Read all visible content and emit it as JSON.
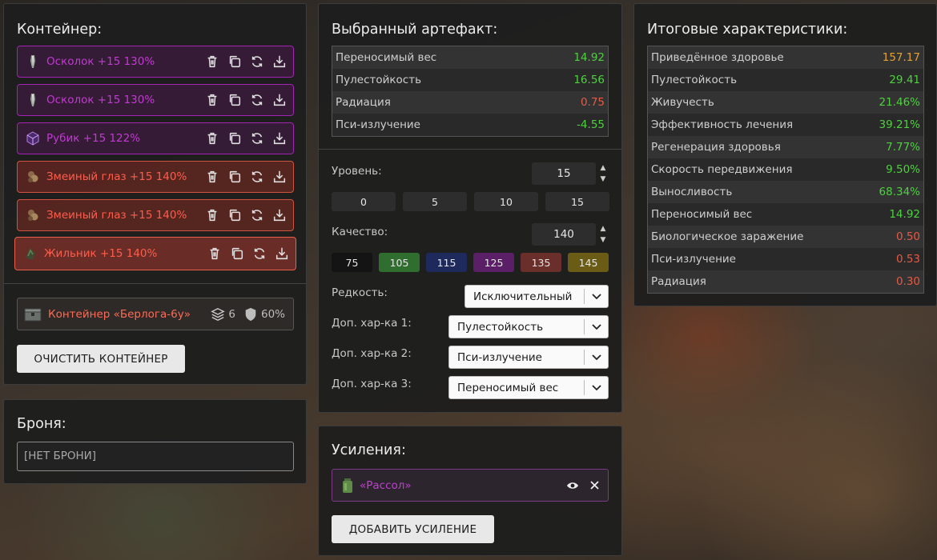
{
  "container": {
    "title": "Контейнер:",
    "items": [
      {
        "name": "Осколок +15 130%",
        "color": "purple"
      },
      {
        "name": "Осколок +15 130%",
        "color": "purple"
      },
      {
        "name": "Рубик +15 122%",
        "color": "purple"
      },
      {
        "name": "Змеиный глаз +15 140%",
        "color": "red"
      },
      {
        "name": "Змеиный глаз +15 140%",
        "color": "red"
      },
      {
        "name": "Жильник +15 140%",
        "color": "red",
        "selected": true
      }
    ],
    "box": {
      "name": "Контейнер «Берлога-6у»",
      "slots": "6",
      "protection": "60%"
    },
    "clear_label": "ОЧИСТИТЬ КОНТЕЙНЕР"
  },
  "armor": {
    "title": "Броня:",
    "value": "[НЕТ БРОНИ]"
  },
  "selected": {
    "title": "Выбранный артефакт:",
    "stats": [
      {
        "label": "Переносимый вес",
        "value": "14.92",
        "tone": "green"
      },
      {
        "label": "Пулестойкость",
        "value": "16.56",
        "tone": "green"
      },
      {
        "label": "Радиация",
        "value": "0.75",
        "tone": "red"
      },
      {
        "label": "Пси-излучение",
        "value": "-4.55",
        "tone": "green"
      }
    ],
    "level_label": "Уровень:",
    "level_value": "15",
    "level_presets": [
      "0",
      "5",
      "10",
      "15"
    ],
    "quality_label": "Качество:",
    "quality_value": "140",
    "quality_presets": [
      {
        "label": "75",
        "color": "#141414"
      },
      {
        "label": "105",
        "color": "#2f6e2f"
      },
      {
        "label": "115",
        "color": "#1f2a5c"
      },
      {
        "label": "125",
        "color": "#5a1f66"
      },
      {
        "label": "135",
        "color": "#6a2f2a"
      },
      {
        "label": "145",
        "color": "#6a5c15"
      }
    ],
    "rarity_label": "Редкость:",
    "rarity_value": "Исключительный",
    "extra1_label": "Доп. хар-ка 1:",
    "extra1_value": "Пулестойкость",
    "extra2_label": "Доп. хар-ка 2:",
    "extra2_value": "Пси-излучение",
    "extra3_label": "Доп. хар-ка 3:",
    "extra3_value": "Переносимый вес"
  },
  "boost": {
    "title": "Усиления:",
    "item_name": "«Рассол»",
    "add_label": "ДОБАВИТЬ УСИЛЕНИЕ"
  },
  "total": {
    "title": "Итоговые характеристики:",
    "stats": [
      {
        "label": "Приведённое здоровье",
        "value": "157.17",
        "tone": "orange"
      },
      {
        "label": "Пулестойкость",
        "value": "29.41",
        "tone": "green"
      },
      {
        "label": "Живучесть",
        "value": "21.46%",
        "tone": "green"
      },
      {
        "label": "Эффективность лечения",
        "value": "39.21%",
        "tone": "green"
      },
      {
        "label": "Регенерация здоровья",
        "value": "7.77%",
        "tone": "green"
      },
      {
        "label": "Скорость передвижения",
        "value": "9.50%",
        "tone": "green"
      },
      {
        "label": "Выносливость",
        "value": "68.34%",
        "tone": "green"
      },
      {
        "label": "Переносимый вес",
        "value": "14.92",
        "tone": "green"
      },
      {
        "label": "Биологическое заражение",
        "value": "0.50",
        "tone": "red"
      },
      {
        "label": "Пси-излучение",
        "value": "0.53",
        "tone": "red"
      },
      {
        "label": "Радиация",
        "value": "0.30",
        "tone": "red"
      }
    ]
  }
}
